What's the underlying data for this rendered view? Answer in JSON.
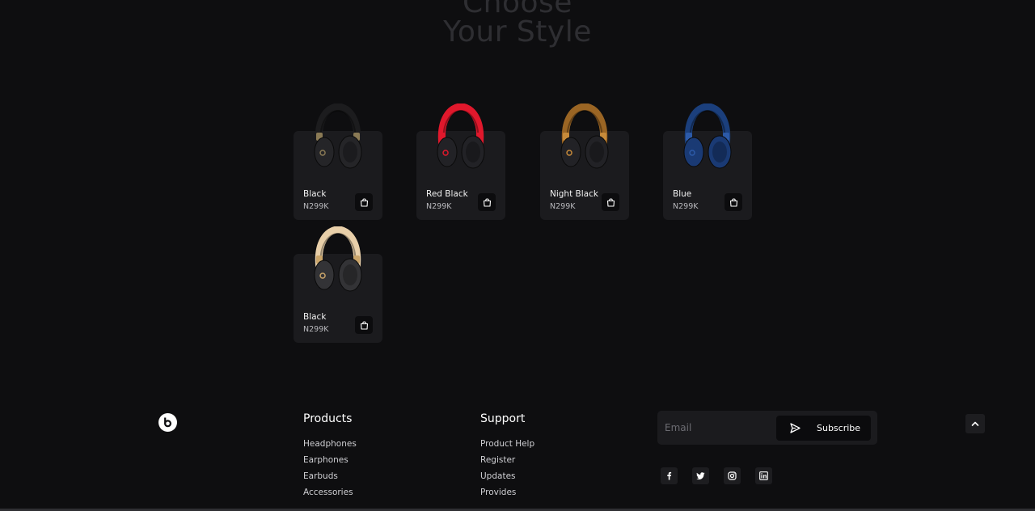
{
  "section": {
    "heading_line1": "Choose",
    "heading_line2": "Your Style"
  },
  "products": [
    {
      "name": "Black",
      "price": "N299K",
      "band_color": "#1c1c1e",
      "cup_color": "#252528",
      "accent_color": "#8a7a55",
      "icon": "shopping-bag-icon"
    },
    {
      "name": "Red Black",
      "price": "N299K",
      "band_color": "#e0182c",
      "cup_color": "#222226",
      "accent_color": "#e0182c",
      "icon": "shopping-bag-icon"
    },
    {
      "name": "Night Black",
      "price": "N299K",
      "band_color": "#9a6524",
      "cup_color": "#222226",
      "accent_color": "#c68a3a",
      "icon": "shopping-bag-icon"
    },
    {
      "name": "Blue",
      "price": "N299K",
      "band_color": "#1b3f7c",
      "cup_color": "#1a3a74",
      "accent_color": "#2c5aa8",
      "icon": "shopping-bag-icon"
    },
    {
      "name": "Black",
      "price": "N299K",
      "band_color": "#e8cfa9",
      "cup_color": "#333336",
      "accent_color": "#caa56a",
      "icon": "shopping-bag-icon"
    }
  ],
  "footer": {
    "logo_icon": "beats-logo-icon",
    "products": {
      "title": "Products",
      "links": [
        "Headphones",
        "Earphones",
        "Earbuds",
        "Accessories"
      ]
    },
    "support": {
      "title": "Support",
      "links": [
        "Product Help",
        "Register",
        "Updates",
        "Provides"
      ]
    },
    "newsletter": {
      "placeholder": "Email",
      "button_label": "Subscribe",
      "button_icon": "send-icon"
    },
    "social": [
      "facebook-icon",
      "twitter-icon",
      "instagram-icon",
      "linkedin-icon"
    ],
    "scroll_top_icon": "chevron-up-icon"
  },
  "colors": {
    "background": "#0e0e10",
    "card": "#1b1b1e",
    "heading": "#2e2e32"
  }
}
